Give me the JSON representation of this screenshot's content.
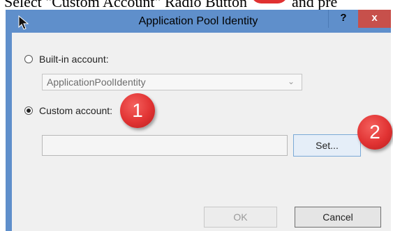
{
  "caption": {
    "lead_text": "Select \"Custom Account\" Radio Button",
    "trail_text": "and pre"
  },
  "window": {
    "title": "Application Pool Identity",
    "help_label": "?",
    "close_label": "x"
  },
  "builtin": {
    "label": "Built-in account:",
    "selected": false,
    "dropdown_value": "ApplicationPoolIdentity"
  },
  "custom": {
    "label": "Custom account:",
    "selected": true,
    "value": ""
  },
  "buttons": {
    "set_label": "Set...",
    "ok_label": "OK",
    "cancel_label": "Cancel"
  },
  "markers": {
    "first": "1",
    "second": "2"
  },
  "icons": {
    "pointer": "mouse-pointer-icon",
    "dropdown": "chevron-down-icon",
    "close": "close-icon",
    "help": "help-icon"
  },
  "colors": {
    "titlebar": "#5f8fcb",
    "close_button": "#c7504b",
    "dialog_body": "#f0f0f0",
    "marker": "#e13333"
  }
}
